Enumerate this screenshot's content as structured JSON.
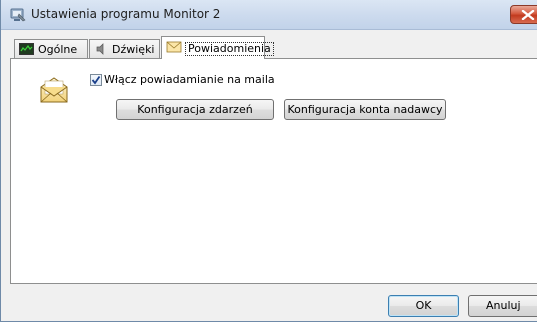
{
  "window": {
    "title": "Ustawienia programu Monitor 2"
  },
  "tabs": [
    {
      "label": "Ogólne",
      "icon": "monitor-icon",
      "active": false
    },
    {
      "label": "Dźwięki",
      "icon": "speaker-icon",
      "active": false
    },
    {
      "label": "Powiadomienia",
      "icon": "envelope-icon",
      "active": true
    }
  ],
  "notifications": {
    "email_checkbox_label": "Włącz powiadamianie na maila",
    "email_checkbox_checked": true,
    "configure_events_label": "Konfiguracja zdarzeń",
    "configure_sender_label": "Konfiguracja konta nadawcy"
  },
  "footer": {
    "ok_label": "OK",
    "cancel_label": "Anuluj"
  },
  "colors": {
    "titlebar": "#cddbee",
    "close_button": "#c23a1f",
    "panel_background": "#ffffff",
    "window_background": "#f0f0f0"
  }
}
